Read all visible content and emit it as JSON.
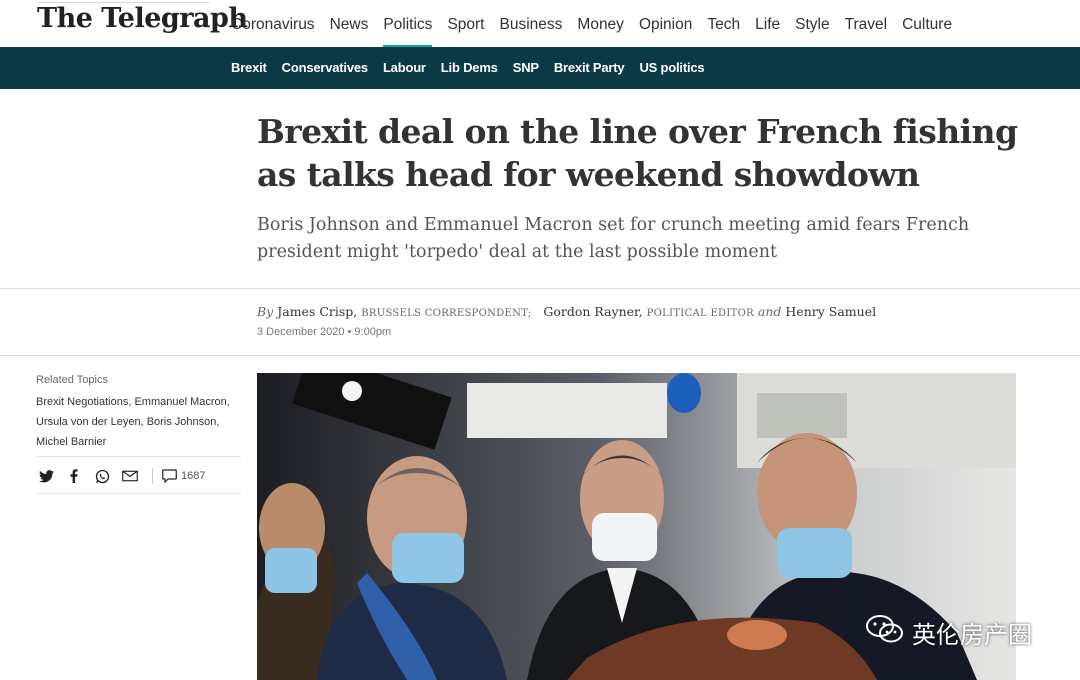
{
  "brand": {
    "logo_text": "The Telegraph"
  },
  "primary_nav": [
    {
      "label": "Coronavirus"
    },
    {
      "label": "News"
    },
    {
      "label": "Politics",
      "active": true
    },
    {
      "label": "Sport"
    },
    {
      "label": "Business"
    },
    {
      "label": "Money"
    },
    {
      "label": "Opinion"
    },
    {
      "label": "Tech"
    },
    {
      "label": "Life"
    },
    {
      "label": "Style"
    },
    {
      "label": "Travel"
    },
    {
      "label": "Culture"
    }
  ],
  "secondary_nav": [
    {
      "label": "Brexit"
    },
    {
      "label": "Conservatives"
    },
    {
      "label": "Labour"
    },
    {
      "label": "Lib Dems"
    },
    {
      "label": "SNP"
    },
    {
      "label": "Brexit Party"
    },
    {
      "label": "US politics"
    }
  ],
  "article": {
    "headline": "Brexit deal on the line over French fishing as talks head for weekend showdown",
    "standfirst": "Boris Johnson and Emmanuel Macron set for crunch meeting amid fears French president might 'torpedo' deal at the last possible moment",
    "byline": {
      "by": "By",
      "author1": "James Crisp,",
      "role1": "BRUSSELS CORRESPONDENT;",
      "author2": "Gordon Rayner,",
      "role2": "POLITICAL EDITOR",
      "and": "and",
      "author3": "Henry Samuel"
    },
    "date": "3 December 2020 • 9:00pm"
  },
  "sidebar": {
    "related_title": "Related Topics",
    "related_topics": [
      "Brexit Negotiations,",
      "Emmanuel Macron,",
      "Ursula von der Leyen,",
      "Boris Johnson,",
      "Michel Barnier"
    ],
    "share_icons": [
      "twitter-icon",
      "facebook-icon",
      "whatsapp-icon",
      "email-icon"
    ],
    "comment_count": "1687"
  },
  "watermark": {
    "text": "英伦房产圈"
  },
  "colors": {
    "nav_bar": "#0b3a46",
    "active_underline": "#00abaa"
  }
}
